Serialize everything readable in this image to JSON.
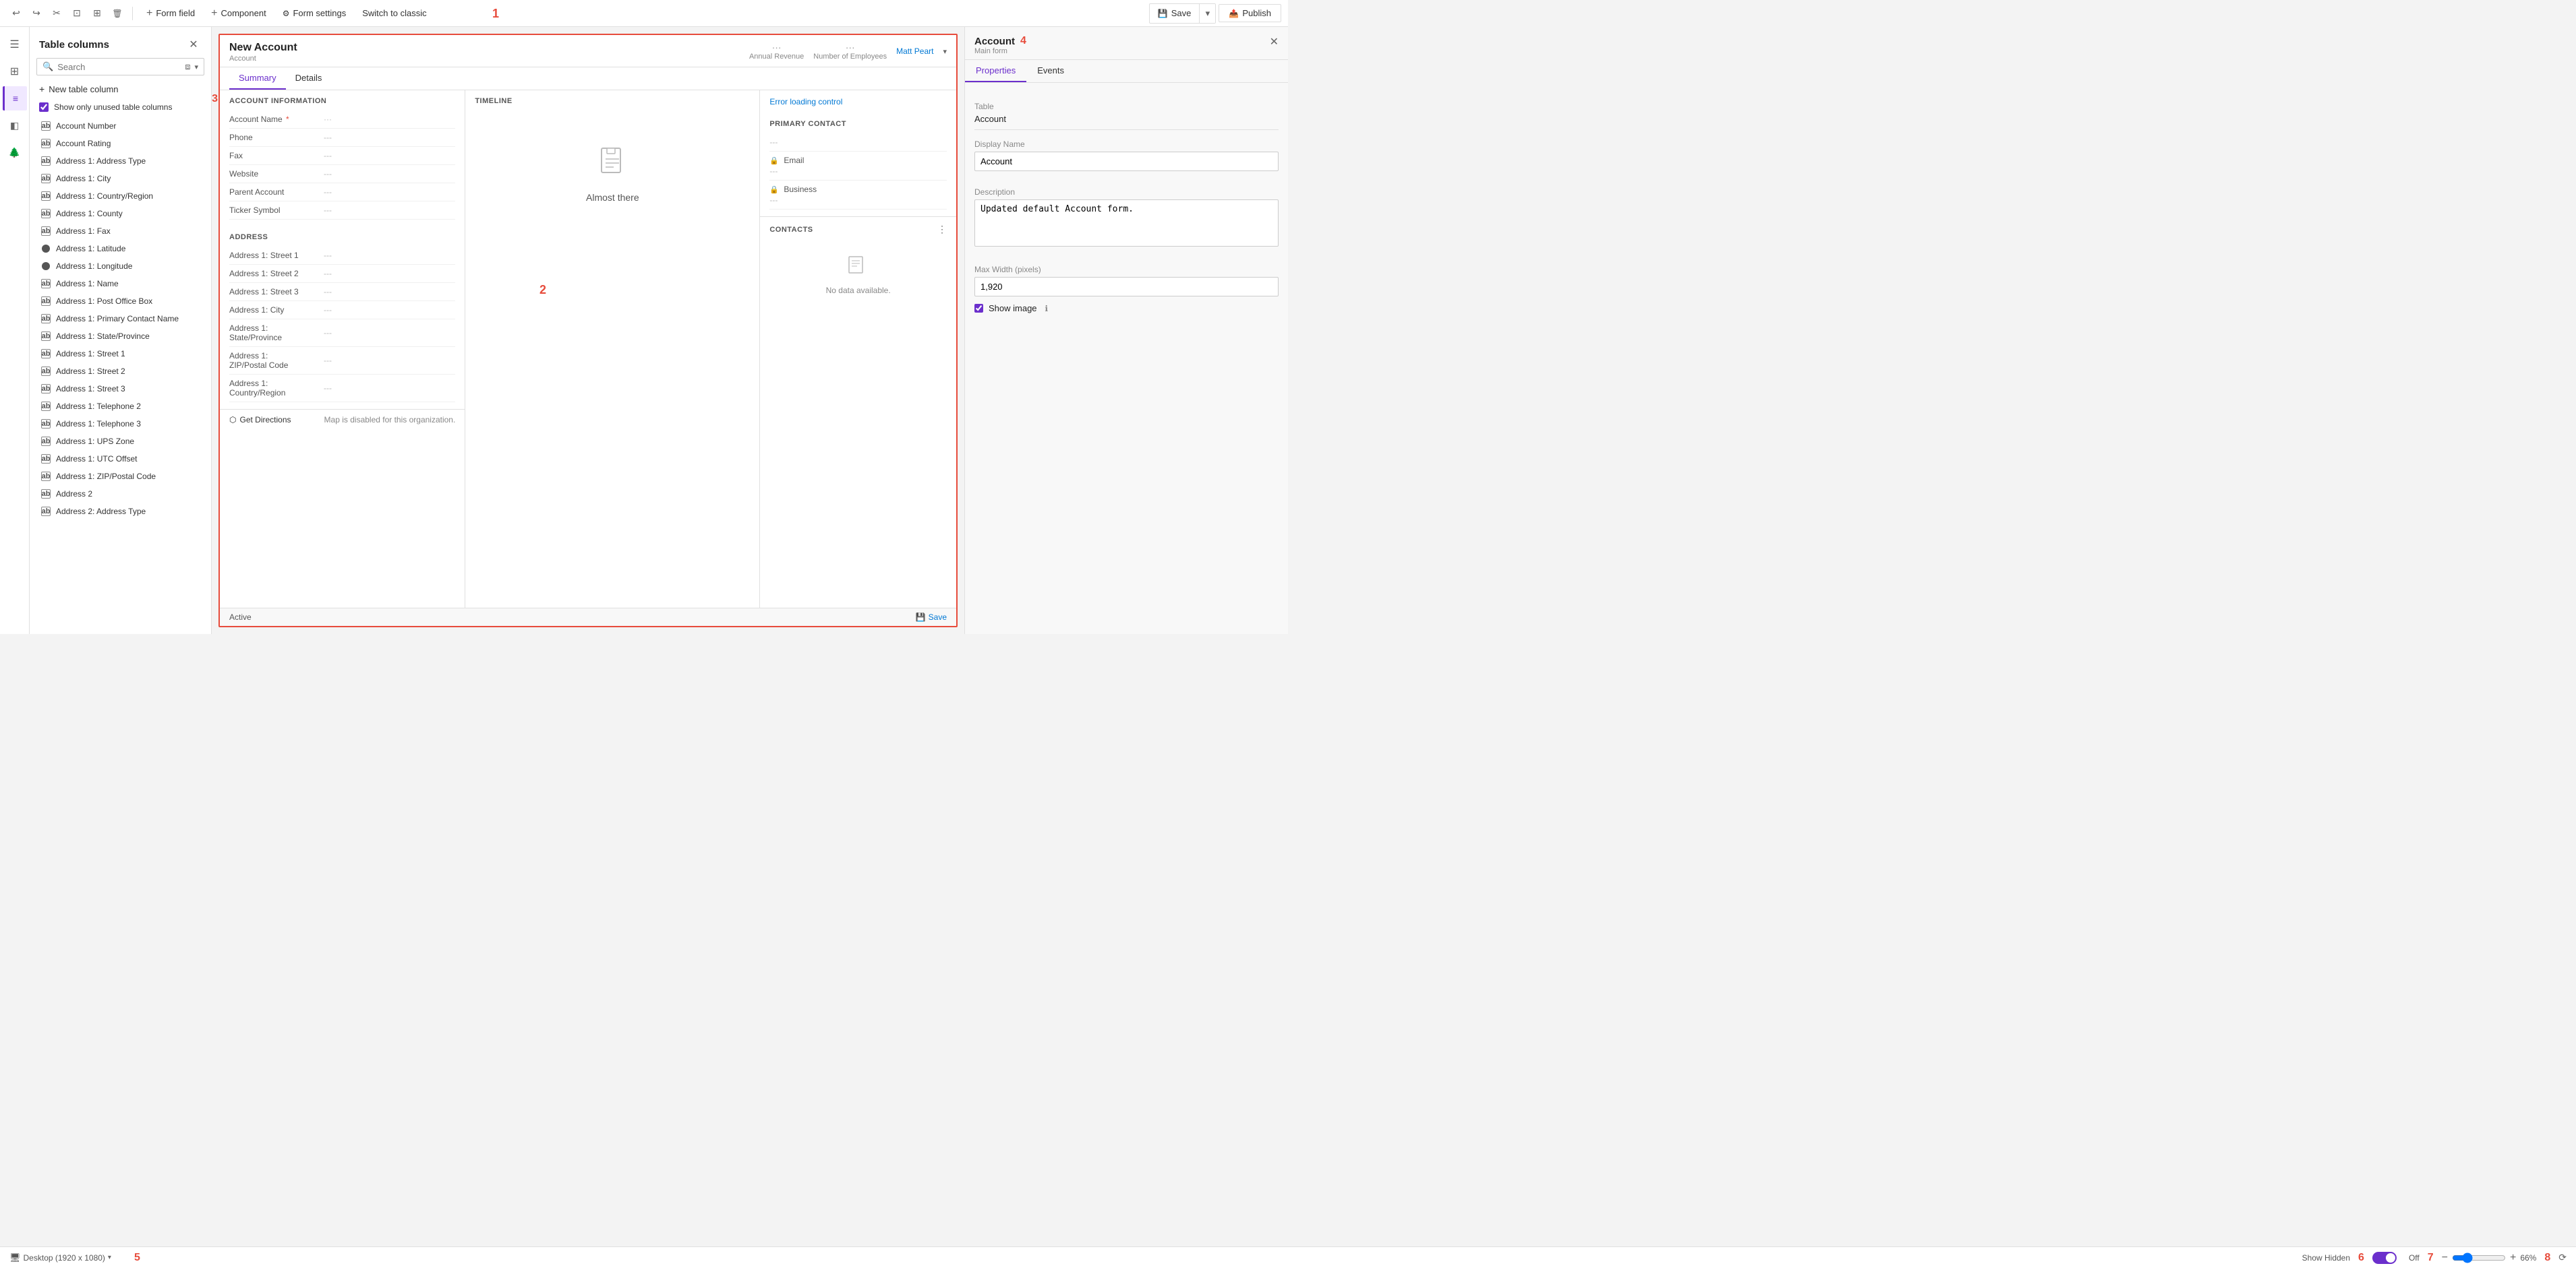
{
  "toolbar": {
    "undo_icon": "↩",
    "redo_icon": "↪",
    "cut_icon": "✂",
    "copy_icon": "⊡",
    "clone_icon": "⊞",
    "delete_icon": "🗑",
    "form_field_label": "Form field",
    "component_label": "Component",
    "form_settings_label": "Form settings",
    "switch_classic_label": "Switch to classic",
    "save_label": "Save",
    "publish_label": "Publish"
  },
  "sidebar": {
    "title": "Table columns",
    "search_placeholder": "Search",
    "show_unused_label": "Show only unused table columns",
    "new_column_label": "New table column",
    "columns": [
      {
        "name": "Account Number",
        "icon": "text"
      },
      {
        "name": "Account Rating",
        "icon": "text"
      },
      {
        "name": "Address 1: Address Type",
        "icon": "text"
      },
      {
        "name": "Address 1: City",
        "icon": "text"
      },
      {
        "name": "Address 1: Country/Region",
        "icon": "text"
      },
      {
        "name": "Address 1: County",
        "icon": "text"
      },
      {
        "name": "Address 1: Fax",
        "icon": "text"
      },
      {
        "name": "Address 1: Latitude",
        "icon": "circle"
      },
      {
        "name": "Address 1: Longitude",
        "icon": "circle"
      },
      {
        "name": "Address 1: Name",
        "icon": "text"
      },
      {
        "name": "Address 1: Post Office Box",
        "icon": "text"
      },
      {
        "name": "Address 1: Primary Contact Name",
        "icon": "text"
      },
      {
        "name": "Address 1: State/Province",
        "icon": "text"
      },
      {
        "name": "Address 1: Street 1",
        "icon": "text"
      },
      {
        "name": "Address 1: Street 2",
        "icon": "text"
      },
      {
        "name": "Address 1: Street 3",
        "icon": "text"
      },
      {
        "name": "Address 1: Telephone 2",
        "icon": "text"
      },
      {
        "name": "Address 1: Telephone 3",
        "icon": "text"
      },
      {
        "name": "Address 1: UPS Zone",
        "icon": "text"
      },
      {
        "name": "Address 1: UTC Offset",
        "icon": "text"
      },
      {
        "name": "Address 1: ZIP/Postal Code",
        "icon": "text"
      },
      {
        "name": "Address 2",
        "icon": "text"
      },
      {
        "name": "Address 2: Address Type",
        "icon": "text"
      }
    ]
  },
  "form": {
    "title": "New Account",
    "subtitle": "Account",
    "header_cols": [
      {
        "dots": "···",
        "label": "Annual Revenue"
      },
      {
        "dots": "···",
        "label": "Number of Employees"
      }
    ],
    "owner_label": "Matt Peart",
    "tabs": [
      "Summary",
      "Details"
    ],
    "active_tab": "Summary",
    "account_info_section": "ACCOUNT INFORMATION",
    "fields": [
      {
        "label": "Account Name",
        "value": "···",
        "required": true
      },
      {
        "label": "Phone",
        "value": "---"
      },
      {
        "label": "Fax",
        "value": "---"
      },
      {
        "label": "Website",
        "value": "---"
      },
      {
        "label": "Parent Account",
        "value": "---"
      },
      {
        "label": "Ticker Symbol",
        "value": "---"
      }
    ],
    "address_section": "ADDRESS",
    "address_fields": [
      {
        "label": "Address 1: Street 1",
        "value": "---"
      },
      {
        "label": "Address 1: Street 2",
        "value": "---"
      },
      {
        "label": "Address 1: Street 3",
        "value": "---"
      },
      {
        "label": "Address 1: City",
        "value": "---"
      },
      {
        "label": "Address 1:\nState/Province",
        "value": "---"
      },
      {
        "label": "Address 1:\nZIP/Postal Code",
        "value": "---"
      },
      {
        "label": "Address 1:\nCountry/Region",
        "value": "---"
      }
    ],
    "map_disabled_text": "Map is disabled for this organization.",
    "get_directions_label": "Get Directions",
    "timeline_label": "Timeline",
    "almost_there_label": "Almost there",
    "error_loading_label": "Error loading control",
    "primary_contact_label": "Primary Contact",
    "email_label": "Email",
    "business_label": "Business",
    "contacts_section_label": "CONTACTS",
    "no_data_label": "No data available.",
    "status_label": "Active",
    "save_btn_label": "💾 Save"
  },
  "right_panel": {
    "title": "Account",
    "subtitle": "Main form",
    "tabs": [
      "Properties",
      "Events"
    ],
    "active_tab": "Properties",
    "table_label": "Table",
    "table_value": "Account",
    "display_name_label": "Display Name",
    "display_name_value": "Account",
    "description_label": "Description",
    "description_value": "Updated default Account form.",
    "max_width_label": "Max Width (pixels)",
    "max_width_value": "1,920",
    "show_image_label": "Show image"
  },
  "bottom_bar": {
    "desktop_label": "Desktop (1920 x 1080)",
    "show_hidden_label": "Show Hidden",
    "off_label": "Off",
    "zoom_label": "66%"
  },
  "red_labels": {
    "label1": "1",
    "label2": "2",
    "label3": "3",
    "label4": "4",
    "label5": "5",
    "label6": "6",
    "label7": "7",
    "label8": "8"
  }
}
